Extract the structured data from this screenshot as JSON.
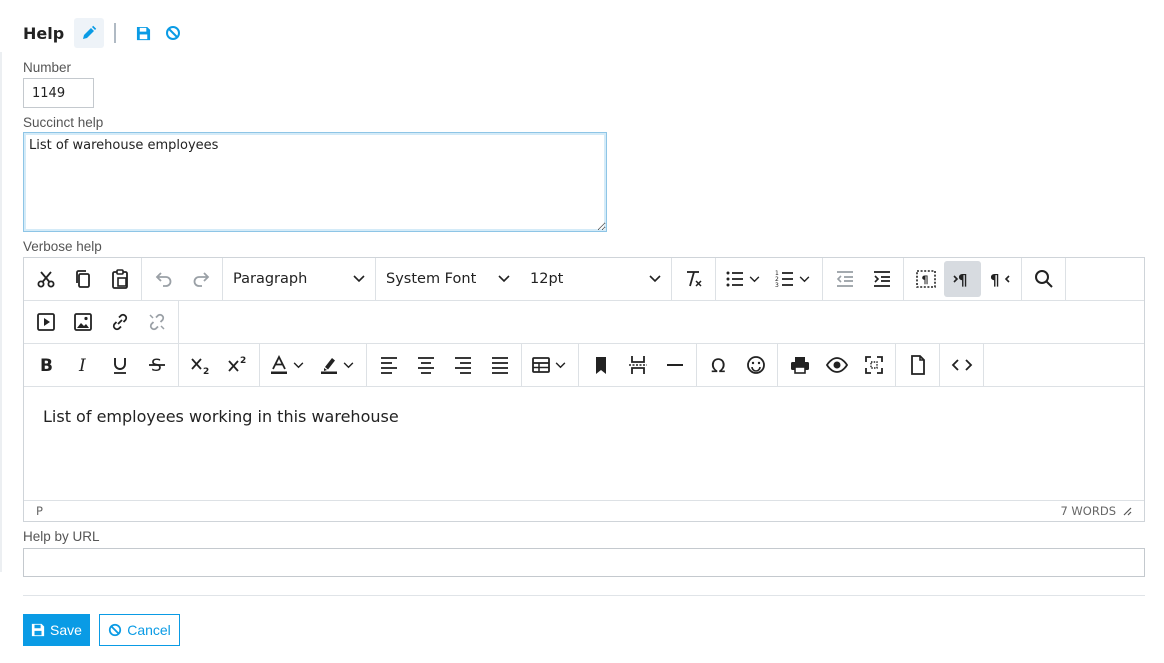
{
  "header": {
    "title": "Help",
    "icons": [
      "pencil-icon",
      "save-icon",
      "cancel-icon"
    ],
    "accent": "#0a9be5"
  },
  "fields": {
    "number_label": "Number",
    "number_value": "1149",
    "succinct_label": "Succinct help",
    "succinct_value": "List of warehouse employees",
    "verbose_label": "Verbose help",
    "url_label": "Help by URL",
    "url_value": ""
  },
  "editor": {
    "block_format": "Paragraph",
    "font_family": "System Font",
    "font_size": "12pt",
    "content": "List of employees working in this warehouse",
    "status_path": "P",
    "word_count": "7 WORDS"
  },
  "actions": {
    "save_label": "Save",
    "cancel_label": "Cancel"
  }
}
